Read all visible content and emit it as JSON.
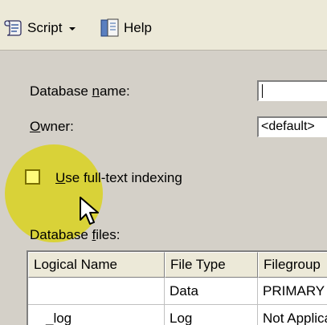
{
  "toolbar": {
    "script_label": "Script",
    "help_label": "Help"
  },
  "form": {
    "database_name_label_pre": "Database ",
    "database_name_label_u": "n",
    "database_name_label_post": "ame:",
    "database_name_value": "",
    "owner_label_u": "O",
    "owner_label_post": "wner:",
    "owner_value": "<default>",
    "fulltext_label_u": "U",
    "fulltext_label_post": "se full-text indexing",
    "fulltext_checked": false,
    "files_label_pre": "Database ",
    "files_label_u": "f",
    "files_label_post": "iles:"
  },
  "grid": {
    "columns": [
      "Logical Name",
      "File Type",
      "Filegroup"
    ],
    "rows": [
      [
        "",
        "Data",
        "PRIMARY"
      ],
      [
        "_log",
        "Log",
        "Not Applicable"
      ]
    ]
  },
  "colors": {
    "highlight": "#dad218",
    "background": "#d4d0c8"
  },
  "icons": [
    "script-icon",
    "dropdown-arrow-icon",
    "help-icon",
    "mouse-pointer-icon"
  ]
}
